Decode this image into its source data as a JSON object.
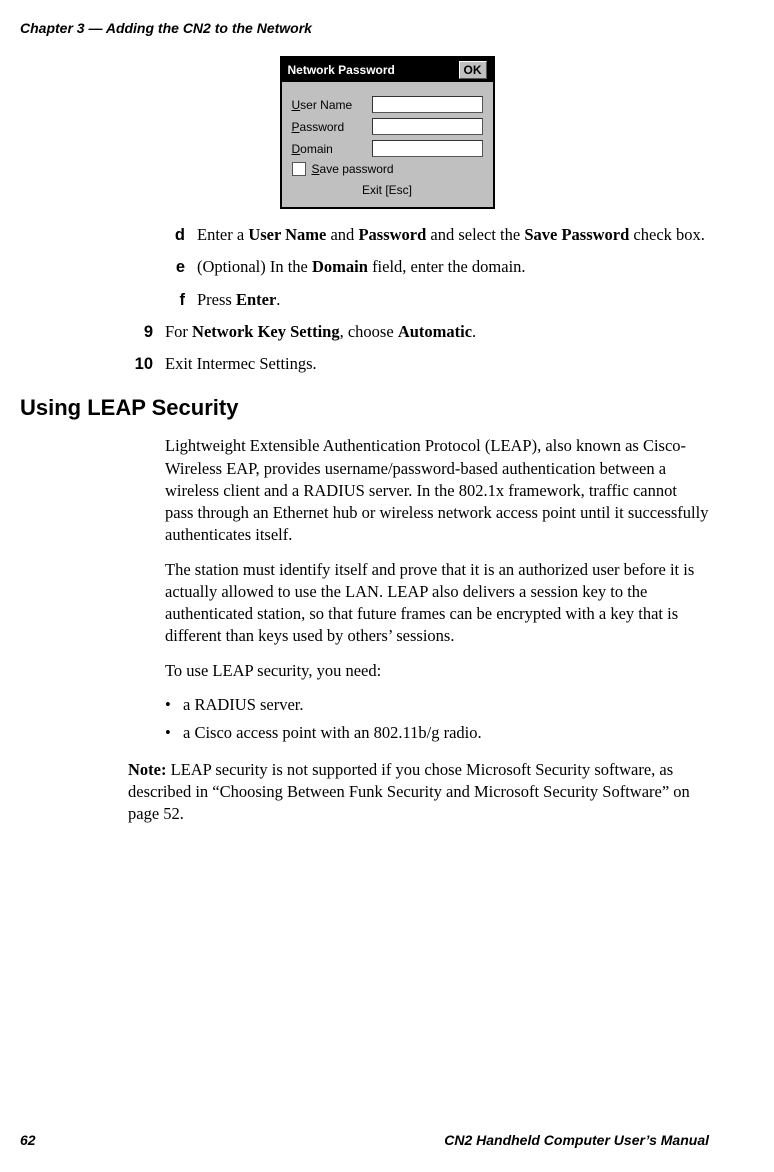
{
  "header": "Chapter 3 — Adding the CN2 to the Network",
  "dialog": {
    "title": "Network Password",
    "ok": "OK",
    "user_label_prefix": "U",
    "user_label_rest": "ser Name",
    "pass_label_prefix": "P",
    "pass_label_rest": "assword",
    "domain_label_prefix": "D",
    "domain_label_rest": "omain",
    "save_label_prefix": "S",
    "save_label_rest": "ave password",
    "exit": "Exit [Esc]"
  },
  "steps": {
    "d": {
      "mk": "d",
      "pre": "Enter a ",
      "b1": "User Name",
      "mid1": " and ",
      "b2": "Password",
      "mid2": " and select the ",
      "b3": "Save Password",
      "post": " check box."
    },
    "e": {
      "mk": "e",
      "pre": "(Optional) In the ",
      "b1": "Domain",
      "post": " field, enter the domain."
    },
    "f": {
      "mk": "f",
      "pre": "Press ",
      "b1": "Enter",
      "post": "."
    },
    "n9": {
      "num": "9",
      "pre": "For ",
      "b1": "Network Key Setting",
      "mid": ", choose ",
      "b2": "Automatic",
      "post": "."
    },
    "n10": {
      "num": "10",
      "txt": "Exit Intermec Settings."
    }
  },
  "heading": "Using LEAP Security",
  "para1": "Lightweight Extensible Authentication Protocol (LEAP), also known as Cisco-Wireless EAP, provides username/password-based authentication between a wireless client and a RADIUS server. In the 802.1x framework, traffic cannot pass through an Ethernet hub or wireless network access point until it successfully authenticates itself.",
  "para2": "The station must identify itself and prove that it is an authorized user before it is actually allowed to use the LAN. LEAP also delivers a session key to the authenticated station, so that future frames can be encrypted with a key that is different than keys used by others’ sessions.",
  "para3": "To use LEAP security, you need:",
  "bullets": {
    "b1": "a RADIUS server.",
    "b2": "a Cisco access point with an 802.11b/g radio."
  },
  "note": {
    "label": "Note:",
    "text": " LEAP security is not supported if you chose Microsoft Security software, as described in “Choosing Between Funk Security and Microsoft Security Software” on page 52."
  },
  "footer": {
    "page": "62",
    "title": "CN2 Handheld Computer User’s Manual"
  }
}
